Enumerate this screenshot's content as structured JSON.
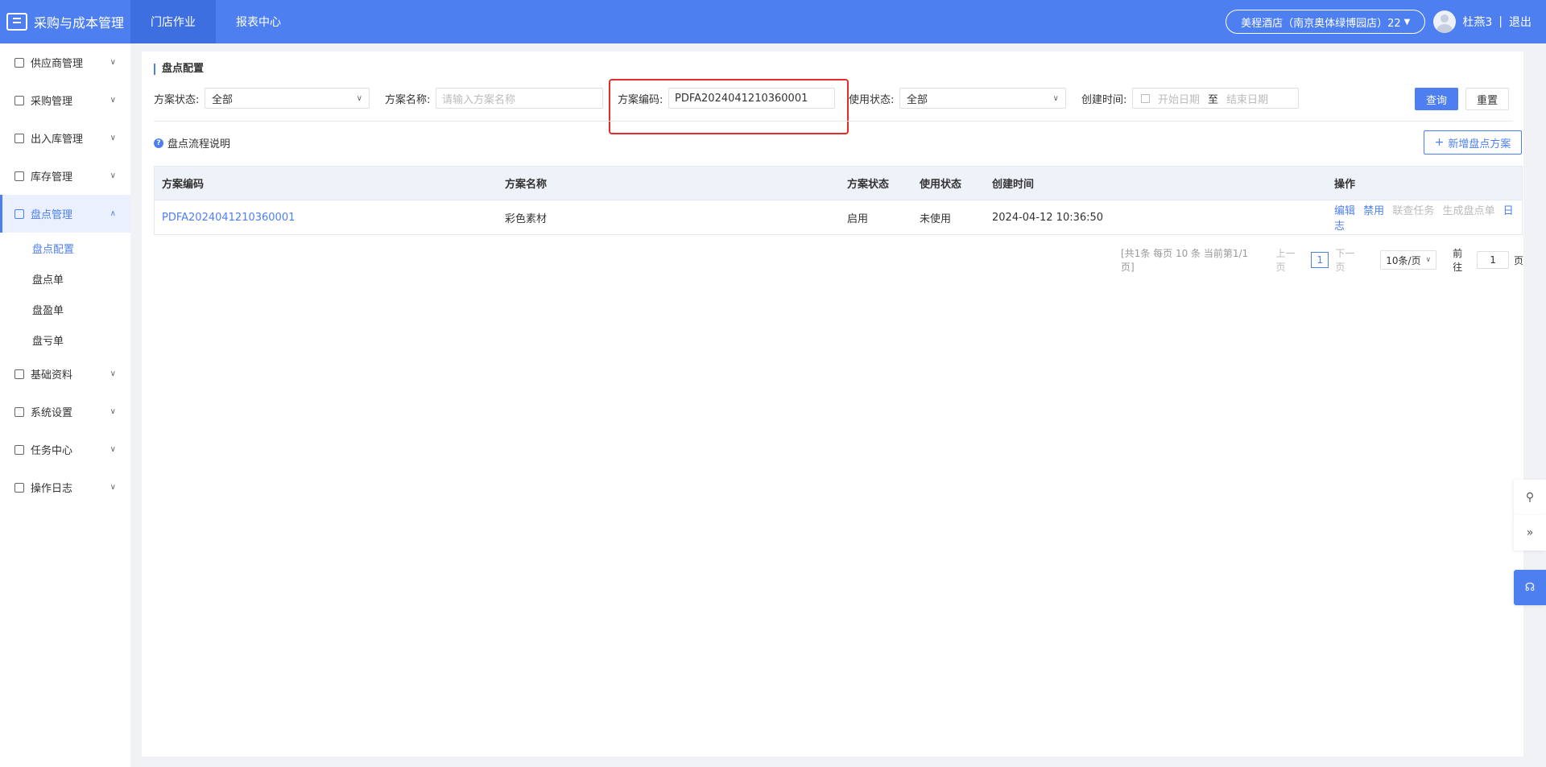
{
  "header": {
    "app_title": "采购与成本管理",
    "nav": [
      "门店作业",
      "报表中心"
    ],
    "store": "美程酒店（南京奥体绿博园店）22",
    "user_name": "杜燕3",
    "separator": "|",
    "logout": "退出"
  },
  "sidebar": {
    "items": [
      {
        "label": "供应商管理"
      },
      {
        "label": "采购管理"
      },
      {
        "label": "出入库管理"
      },
      {
        "label": "库存管理"
      },
      {
        "label": "盘点管理"
      },
      {
        "label": "基础资料"
      },
      {
        "label": "系统设置"
      },
      {
        "label": "任务中心"
      },
      {
        "label": "操作日志"
      }
    ],
    "submenu": [
      "盘点配置",
      "盘点单",
      "盘盈单",
      "盘亏单"
    ]
  },
  "page": {
    "title": "盘点配置",
    "filters": {
      "plan_status_label": "方案状态:",
      "plan_status_value": "全部",
      "plan_name_label": "方案名称:",
      "plan_name_placeholder": "请输入方案名称",
      "plan_code_label": "方案编码:",
      "plan_code_value": "PDFA2024041210360001",
      "use_status_label": "使用状态:",
      "use_status_value": "全部",
      "create_time_label": "创建时间:",
      "start_placeholder": "开始日期",
      "to": "至",
      "end_placeholder": "结束日期"
    },
    "query_button": "查询",
    "reset_button": "重置",
    "help_link": "盘点流程说明",
    "add_button": "新增盘点方案"
  },
  "table": {
    "headers": [
      "方案编码",
      "方案名称",
      "方案状态",
      "使用状态",
      "创建时间",
      "操作"
    ],
    "rows": [
      {
        "code": "PDFA2024041210360001",
        "name": "彩色素材",
        "status": "启用",
        "use_status": "未使用",
        "created": "2024-04-12 10:36:50",
        "actions": [
          {
            "label": "编辑",
            "enabled": true
          },
          {
            "label": "禁用",
            "enabled": true
          },
          {
            "label": "联查任务",
            "enabled": false
          },
          {
            "label": "生成盘点单",
            "enabled": false
          },
          {
            "label": "日志",
            "enabled": true
          }
        ]
      }
    ]
  },
  "pagination": {
    "summary": "[共1条 每页 10 条 当前第1/1页]",
    "prev": "上一页",
    "current": "1",
    "next": "下一页",
    "page_size": "10条/页",
    "goto_label": "前往",
    "goto_value": "1",
    "goto_suffix": "页"
  }
}
